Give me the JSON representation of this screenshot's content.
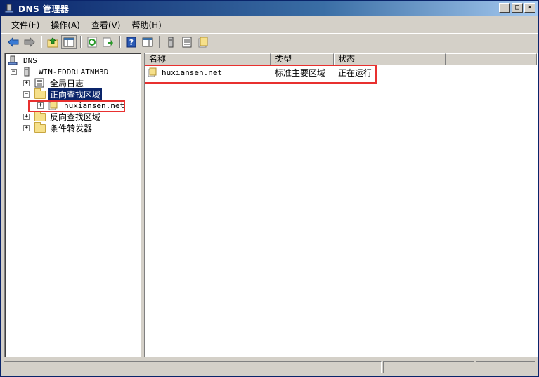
{
  "window": {
    "title": "DNS 管理器",
    "controls": [
      "_",
      "□",
      "×"
    ]
  },
  "menu": [
    {
      "label": "文件(F)"
    },
    {
      "label": "操作(A)"
    },
    {
      "label": "查看(V)"
    },
    {
      "label": "帮助(H)"
    }
  ],
  "toolbar": {
    "buttons": [
      "back-icon",
      "forward-icon",
      "up-icon",
      "show-hide-tree-icon",
      "refresh-icon",
      "export-icon",
      "help-icon",
      "properties-icon",
      "server-icon",
      "list-icon",
      "zone-icon"
    ]
  },
  "tree": {
    "root": "DNS",
    "server": "WIN-EDDRLATNM3D",
    "global_log": "全局日志",
    "forward_zone": "正向查找区域",
    "forward_child": "huxiansen.net",
    "reverse_zone": "反向查找区域",
    "conditional_forwarders": "条件转发器"
  },
  "list": {
    "columns": [
      "名称",
      "类型",
      "状态"
    ],
    "rows": [
      {
        "name": "huxiansen.net",
        "type": "标准主要区域",
        "status": "正在运行"
      }
    ]
  },
  "colors": {
    "selection": "#0a246a",
    "highlight_box": "#e8302f",
    "title_bar": "#0a246a"
  }
}
